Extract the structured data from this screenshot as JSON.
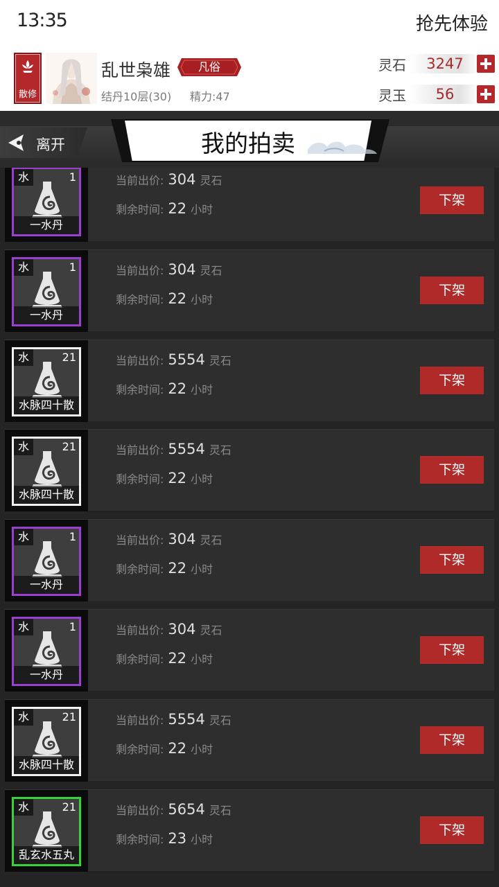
{
  "status_bar": {
    "time": "13:35",
    "right_text": "抢先体验"
  },
  "profile": {
    "sect_badge": "散修",
    "player_name": "乱世枭雄",
    "rank": "凡俗",
    "level": "结丹10层(30)",
    "energy": "精力:47",
    "currencies": [
      {
        "label": "灵石",
        "value": "3247"
      },
      {
        "label": "灵玉",
        "value": "56"
      }
    ]
  },
  "title_bar": {
    "leave_label": "离开",
    "title": "我的拍卖"
  },
  "listing": {
    "price_label": "当前出价:",
    "time_label": "剩余时间:",
    "price_unit": "灵石",
    "time_unit": "小时",
    "delist_label": "下架"
  },
  "items": [
    {
      "element": "水",
      "qty": "1",
      "name": "一水丹",
      "rarity": "purple",
      "price": "304",
      "hours": "22"
    },
    {
      "element": "水",
      "qty": "1",
      "name": "一水丹",
      "rarity": "purple",
      "price": "304",
      "hours": "22"
    },
    {
      "element": "水",
      "qty": "21",
      "name": "水脉四十散",
      "rarity": "white",
      "price": "5554",
      "hours": "22"
    },
    {
      "element": "水",
      "qty": "21",
      "name": "水脉四十散",
      "rarity": "white",
      "price": "5554",
      "hours": "22"
    },
    {
      "element": "水",
      "qty": "1",
      "name": "一水丹",
      "rarity": "purple",
      "price": "304",
      "hours": "22"
    },
    {
      "element": "水",
      "qty": "1",
      "name": "一水丹",
      "rarity": "purple",
      "price": "304",
      "hours": "22"
    },
    {
      "element": "水",
      "qty": "21",
      "name": "水脉四十散",
      "rarity": "white",
      "price": "5554",
      "hours": "22"
    },
    {
      "element": "水",
      "qty": "21",
      "name": "乱玄水五丸",
      "rarity": "green",
      "price": "5654",
      "hours": "23"
    }
  ],
  "colors": {
    "accent_red": "#b02a2a",
    "rarity_purple": "#9b3fd0",
    "rarity_white": "#f2f2f2",
    "rarity_green": "#36d43b"
  }
}
